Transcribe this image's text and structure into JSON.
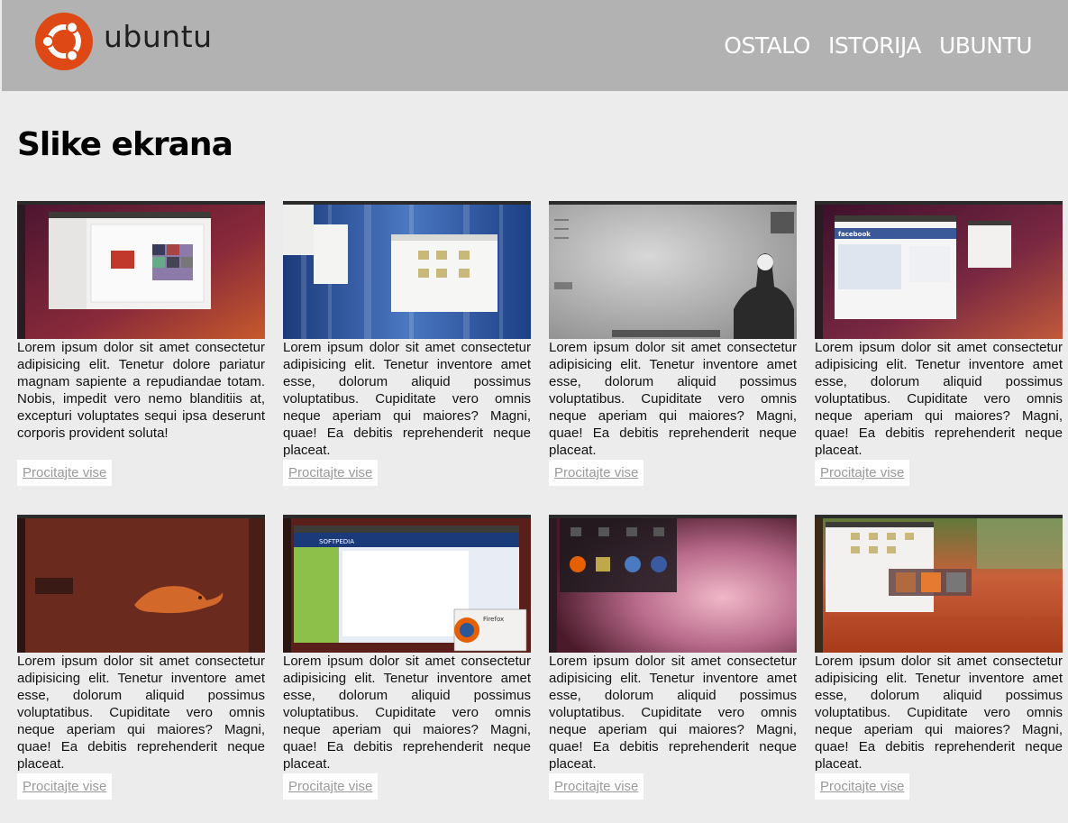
{
  "brand": {
    "name": "ubuntu",
    "accent": "#dd4814"
  },
  "nav": [
    {
      "label": "OSTALO"
    },
    {
      "label": "ISTORIJA"
    },
    {
      "label": "UBUNTU"
    }
  ],
  "page": {
    "title": "Slike ekrana"
  },
  "cards": [
    {
      "theme": "unity-settings",
      "text": "Lorem ipsum dolor sit amet consectetur adipisicing elit. Tenetur dolore pariatur magnam sapiente a repudiandae totam. Nobis, impedit vero nemo blanditiis at, excepturi voluptates sequi ipsa deserunt corporis provident soluta!",
      "link": "Procitajte vise"
    },
    {
      "theme": "blue-files",
      "text": "Lorem ipsum dolor sit amet consectetur adipisicing elit. Tenetur inventore amet esse, dolorum aliquid possimus voluptatibus. Cupiditate vero omnis neque aperiam qui maiores? Magni, quae! Ea debitis reprehenderit neque placeat.",
      "link": "Procitajte vise"
    },
    {
      "theme": "grey-trooper",
      "text": "Lorem ipsum dolor sit amet consectetur adipisicing elit. Tenetur inventore amet esse, dolorum aliquid possimus voluptatibus. Cupiditate vero omnis neque aperiam qui maiores? Magni, quae! Ea debitis reprehenderit neque placeat.",
      "link": "Procitajte vise"
    },
    {
      "theme": "facebook",
      "text": "Lorem ipsum dolor sit amet consectetur adipisicing elit. Tenetur inventore amet esse, dolorum aliquid possimus voluptatibus. Cupiditate vero omnis neque aperiam qui maiores? Magni, quae! Ea debitis reprehenderit neque placeat.",
      "link": "Procitajte vise"
    },
    {
      "theme": "pangolin",
      "text": "Lorem ipsum dolor sit amet consectetur adipisicing elit. Tenetur inventore amet esse, dolorum aliquid possimus voluptatibus. Cupiditate vero omnis neque aperiam qui maiores? Magni, quae! Ea debitis reprehenderit neque placeat.",
      "link": "Procitajte vise"
    },
    {
      "theme": "softpedia",
      "text": "Lorem ipsum dolor sit amet consectetur adipisicing elit. Tenetur inventore amet esse, dolorum aliquid possimus voluptatibus. Cupiditate vero omnis neque aperiam qui maiores? Magni, quae! Ea debitis reprehenderit neque placeat.",
      "link": "Procitajte vise"
    },
    {
      "theme": "dash",
      "text": "Lorem ipsum dolor sit amet consectetur adipisicing elit. Tenetur inventore amet esse, dolorum aliquid possimus voluptatibus. Cupiditate vero omnis neque aperiam qui maiores? Magni, quae! Ea debitis reprehenderit neque placeat.",
      "link": "Procitajte vise"
    },
    {
      "theme": "autumn",
      "text": "Lorem ipsum dolor sit amet consectetur adipisicing elit. Tenetur inventore amet esse, dolorum aliquid possimus voluptatibus. Cupiditate vero omnis neque aperiam qui maiores? Magni, quae! Ea debitis reprehenderit neque placeat.",
      "link": "Procitajte vise"
    }
  ],
  "thumb_labels": {
    "facebook": "facebook",
    "softpedia": "SOFTPEDIA",
    "firefox": "Firefox"
  }
}
